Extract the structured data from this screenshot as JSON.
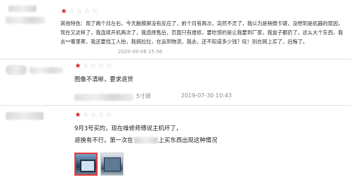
{
  "reviews": [
    {
      "rating": 1,
      "text": "其他特色：用了两个月左右，今天触摸屏没有反应了，前个月有两次，突然不灵了，我以为是稍微卡顿，没想到是机器的原因，现在又这样了，我连续开机两次了，我选择售后，页面只有维修，要吃惊的是让我要到厂家，我盒子都扔了，这么大个东西，我去**哪里寄，我还要找工人抬，我搞拉拉，在运到物流，我去，还不知道多少钱？叹！别在网上买了，后悔了。",
      "date": "2020-09-06 15:56"
    },
    {
      "rating": 1,
      "text": "图像不清晰，要求退货",
      "spec": "5寸屏",
      "date": "2019-07-30 10:43"
    },
    {
      "rating": 1,
      "line1": "9月3号买的，现在维修师傅说主机坏了，",
      "line2a": "退换有不行，第一次在",
      "line2b": "上买东西出现这种情况",
      "photos": [
        "photo-1",
        "photo-2"
      ]
    }
  ],
  "star_glyph_filled": "★",
  "star_glyph_empty": "☆",
  "colors": {
    "accent": "#d41e1e",
    "meta": "#999999"
  }
}
